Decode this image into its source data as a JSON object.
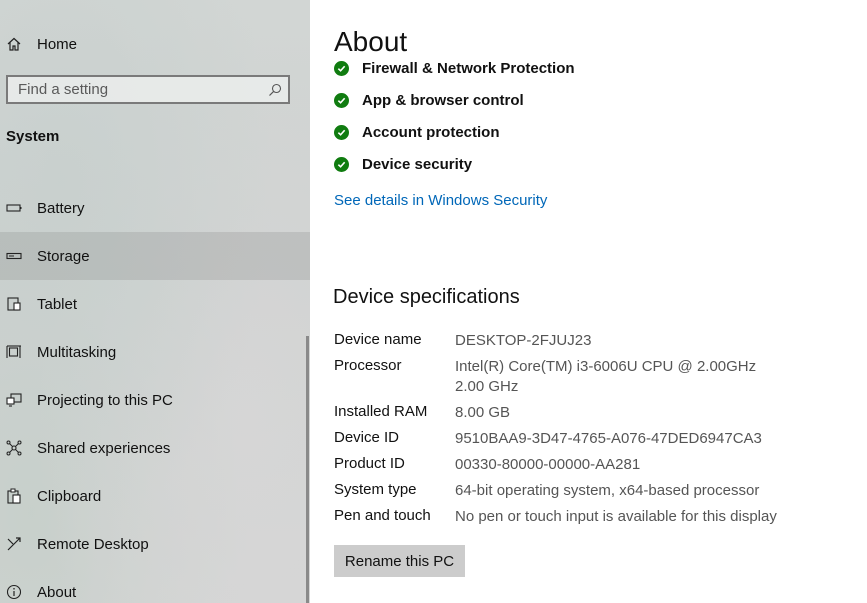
{
  "sidebar": {
    "home_label": "Home",
    "search_placeholder": "Find a setting",
    "section_title": "System",
    "items": [
      {
        "label": "Battery",
        "icon": "battery-icon"
      },
      {
        "label": "Storage",
        "icon": "storage-icon"
      },
      {
        "label": "Tablet",
        "icon": "tablet-icon"
      },
      {
        "label": "Multitasking",
        "icon": "multitasking-icon"
      },
      {
        "label": "Projecting to this PC",
        "icon": "projecting-icon"
      },
      {
        "label": "Shared experiences",
        "icon": "shared-experiences-icon"
      },
      {
        "label": "Clipboard",
        "icon": "clipboard-icon"
      },
      {
        "label": "Remote Desktop",
        "icon": "remote-desktop-icon"
      },
      {
        "label": "About",
        "icon": "about-icon"
      }
    ],
    "selected_item": "Storage"
  },
  "main": {
    "title": "About",
    "security_items": [
      "Firewall & Network Protection",
      "App & browser control",
      "Account protection",
      "Device security"
    ],
    "security_link": "See details in Windows Security",
    "device_specs_title": "Device specifications",
    "specs": [
      {
        "key": "Device name",
        "value": "DESKTOP-2FJUJ23"
      },
      {
        "key": "Processor",
        "value": "Intel(R) Core(TM) i3-6006U CPU @ 2.00GHz   2.00 GHz"
      },
      {
        "key": "Installed RAM",
        "value": "8.00 GB"
      },
      {
        "key": "Device ID",
        "value": "9510BAA9-3D47-4765-A076-47DED6947CA3"
      },
      {
        "key": "Product ID",
        "value": "00330-80000-00000-AA281"
      },
      {
        "key": "System type",
        "value": "64-bit operating system, x64-based processor"
      },
      {
        "key": "Pen and touch",
        "value": "No pen or touch input is available for this display"
      }
    ],
    "rename_button": "Rename this PC"
  },
  "colors": {
    "accent_link": "#0067b8",
    "check_green": "#107c10",
    "selected_row": "#bdbdbd",
    "button_bg": "#cccccc"
  }
}
